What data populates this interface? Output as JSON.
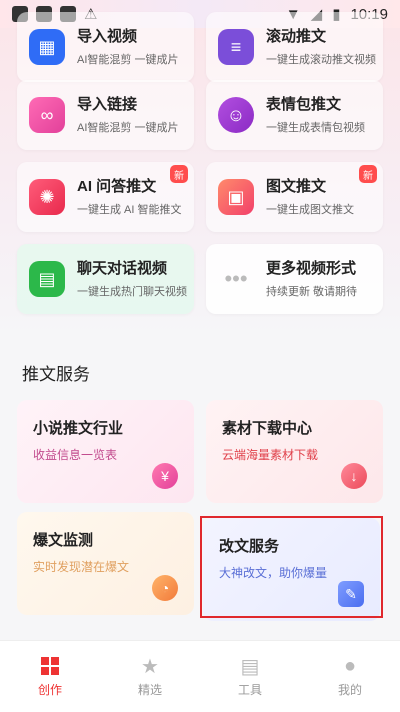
{
  "status_bar": {
    "time": "10:19"
  },
  "partial_top_tiles": [
    {
      "title": "导入视频",
      "subtitle": "AI智能混剪  一键成片"
    },
    {
      "title": "滚动推文",
      "subtitle": "一键生成滚动推文视频"
    }
  ],
  "tiles": [
    {
      "title": "导入链接",
      "subtitle": "AI智能混剪  一键成片",
      "icon": "link-icon",
      "new": false
    },
    {
      "title": "表情包推文",
      "subtitle": "一键生成表情包视频",
      "icon": "smile-icon",
      "new": false
    },
    {
      "title": "AI 问答推文",
      "subtitle": "一键生成 AI 智能推文",
      "icon": "ai-icon",
      "new": true
    },
    {
      "title": "图文推文",
      "subtitle": "一键生成图文推文",
      "icon": "image-icon",
      "new": true
    },
    {
      "title": "聊天对话视频",
      "subtitle": "一键生成热门聊天视频",
      "icon": "chat-icon",
      "new": false
    },
    {
      "title": "更多视频形式",
      "subtitle": "持续更新 敬请期待",
      "icon": "more-icon",
      "new": false
    }
  ],
  "new_badge": "新",
  "section": {
    "title": "推文服务"
  },
  "services": [
    {
      "title": "小说推文行业",
      "subtitle": "收益信息一览表",
      "subtitle_color": "#c24a8d"
    },
    {
      "title": "素材下载中心",
      "subtitle": "云端海量素材下载",
      "subtitle_color": "#e0404a"
    },
    {
      "title": "爆文监测",
      "subtitle": "实时发现潜在爆文",
      "subtitle_color": "#e0a060"
    },
    {
      "title": "改文服务",
      "subtitle": "大神改文，助你爆量",
      "subtitle_color": "#5a6fd6"
    }
  ],
  "tabbar": {
    "items": [
      {
        "label": "创作",
        "active": true
      },
      {
        "label": "精选",
        "active": false
      },
      {
        "label": "工具",
        "active": false
      },
      {
        "label": "我的",
        "active": false
      }
    ]
  }
}
